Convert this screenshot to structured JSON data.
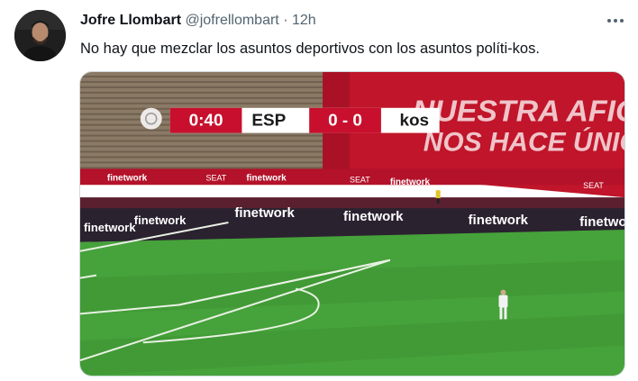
{
  "tweet": {
    "author_name": "Jofre Llombart",
    "handle": "@jofrellombart",
    "separator": "·",
    "time": "12h",
    "text": "No hay que mezclar los asuntos deportivos con los asuntos políti-kos."
  },
  "icons": {
    "avatar": "avatar-photo",
    "more": "more-horizontal-icon"
  },
  "media": {
    "scoreboard": {
      "clock": "0:40",
      "home": "ESP",
      "score": "0 - 0",
      "away": "kos"
    },
    "banner": {
      "line1": "NUESTRA AFICIÓN",
      "line2": "NOS HACE ÚNICOS"
    },
    "boards": [
      "finetwork",
      "finetwork",
      "finetwork",
      "finetwork",
      "finetwork",
      "finetwork"
    ],
    "upper_ads": [
      "finetwork",
      "SEAT",
      "finetwork",
      "SEAT",
      "finetwork",
      "SEAT"
    ]
  },
  "colors": {
    "pitch_light": "#46a23a",
    "pitch_dark": "#3d9533",
    "banner_red": "#c0152a",
    "scoreboard_red": "#c8102e",
    "boards_dark": "#2b2230"
  }
}
